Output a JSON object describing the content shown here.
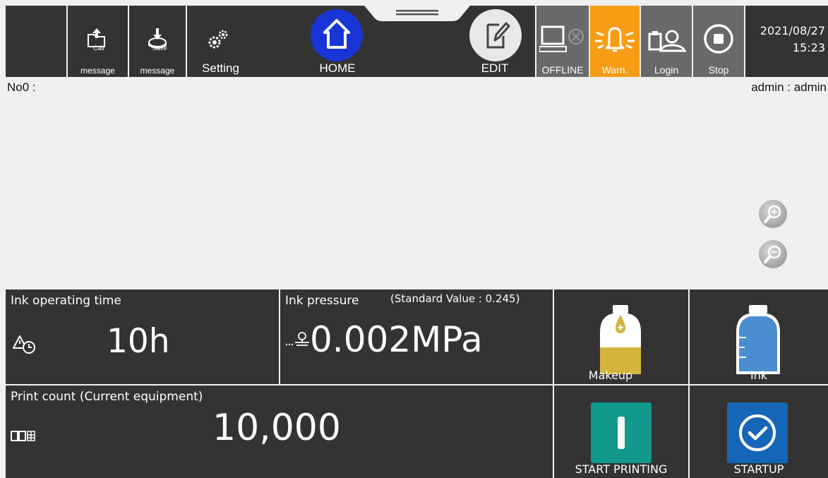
{
  "toolbar": {
    "call_message_label": "message",
    "call_icon_text": "Call",
    "save_message_label": "message",
    "save_icon_text": "Save",
    "setting_label": "Setting",
    "home_label": "HOME",
    "edit_label": "EDIT",
    "offline_label": "OFFLINE",
    "warn_label": "Warn.",
    "login_label": "Login",
    "stop_label": "Stop",
    "date": "2021/08/27",
    "time": "15:23"
  },
  "message": {
    "number_label": "No0 :",
    "user_label": "admin : admin"
  },
  "ink_time": {
    "title": "Ink operating time",
    "value": "10h"
  },
  "ink_pressure": {
    "title": "Ink pressure",
    "standard": "(Standard Value : 0.245)",
    "value": "0.002MPa"
  },
  "makeup": {
    "label": "Makeup"
  },
  "ink": {
    "label": "Ink"
  },
  "print_count": {
    "title": "Print count (Current equipment)",
    "value": "10,000"
  },
  "actions": {
    "start_printing_label": "START PRINTING",
    "startup_label": "STARTUP"
  },
  "colors": {
    "toolbar_bg": "#333333",
    "warn_bg": "#f79c14",
    "home_blue": "#1a35d6",
    "start_printing_teal": "#11998e",
    "startup_blue": "#1666b8",
    "makeup_yellow": "#d4b53c",
    "ink_blue": "#4a8ed0"
  }
}
